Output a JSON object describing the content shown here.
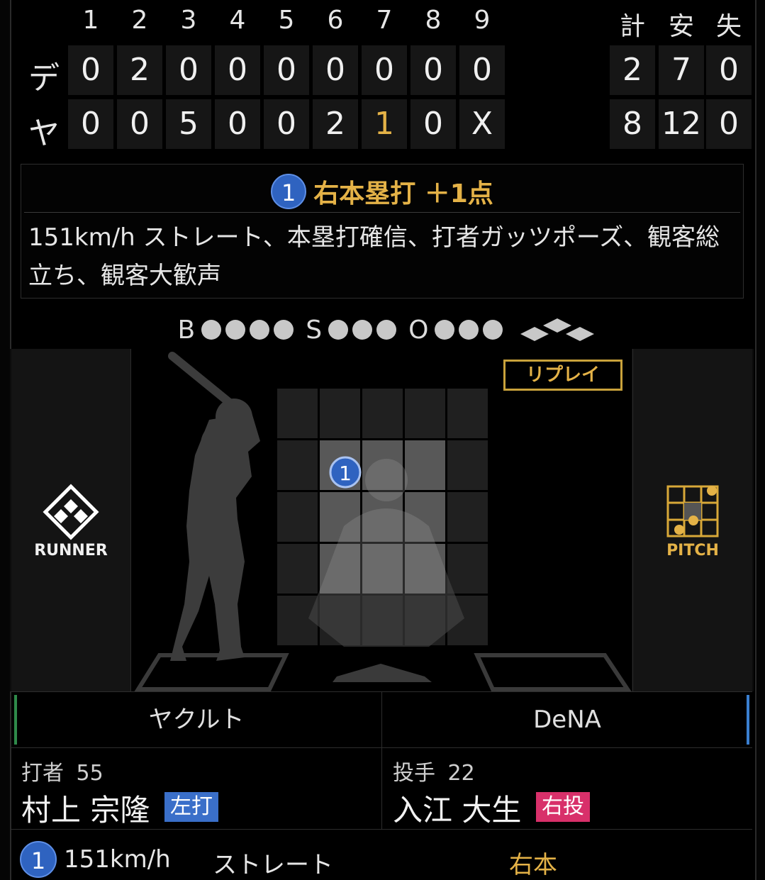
{
  "scoreboard": {
    "innings": [
      "1",
      "2",
      "3",
      "4",
      "5",
      "6",
      "7",
      "8",
      "9"
    ],
    "totals_headers": [
      "計",
      "安",
      "失"
    ],
    "rows": [
      {
        "team": "デ",
        "scores": [
          "0",
          "2",
          "0",
          "0",
          "0",
          "0",
          "0",
          "0",
          "0"
        ],
        "totals": [
          "2",
          "7",
          "0"
        ]
      },
      {
        "team": "ヤ",
        "scores": [
          "0",
          "0",
          "5",
          "0",
          "0",
          "2",
          "1",
          "0",
          "X"
        ],
        "totals": [
          "8",
          "12",
          "0"
        ]
      }
    ]
  },
  "event": {
    "ball_number": "1",
    "title": "右本塁打 ＋1点",
    "description": "151km/h ストレート、本塁打確信、打者ガッツポーズ、観客総立ち、観客大歓声"
  },
  "count": {
    "b_label": "B",
    "s_label": "S",
    "o_label": "O",
    "balls": 4,
    "strikes": 3,
    "outs": 3
  },
  "zone": {
    "replay_label": "リプレイ",
    "pitch_marker": "1"
  },
  "side_buttons": {
    "left_label": "RUNNER",
    "right_label": "PITCH"
  },
  "teams": {
    "left": "ヤクルト",
    "right": "DeNA"
  },
  "batter": {
    "role": "打者",
    "number": "55",
    "name": "村上 宗隆",
    "hand": "左打"
  },
  "pitcher": {
    "role": "投手",
    "number": "22",
    "name": "入江 大生",
    "hand": "右投"
  },
  "pitch_log": {
    "index": "1",
    "speed": "151km/h",
    "type": "ストレート",
    "result": "右本"
  },
  "colors": {
    "gold": "#e4b247",
    "blue": "#2f63c0",
    "pink": "#d8306a",
    "batter_badge": "#3a6fc9",
    "left_accent": "#2f8a4a",
    "right_accent": "#3a7fd0"
  }
}
